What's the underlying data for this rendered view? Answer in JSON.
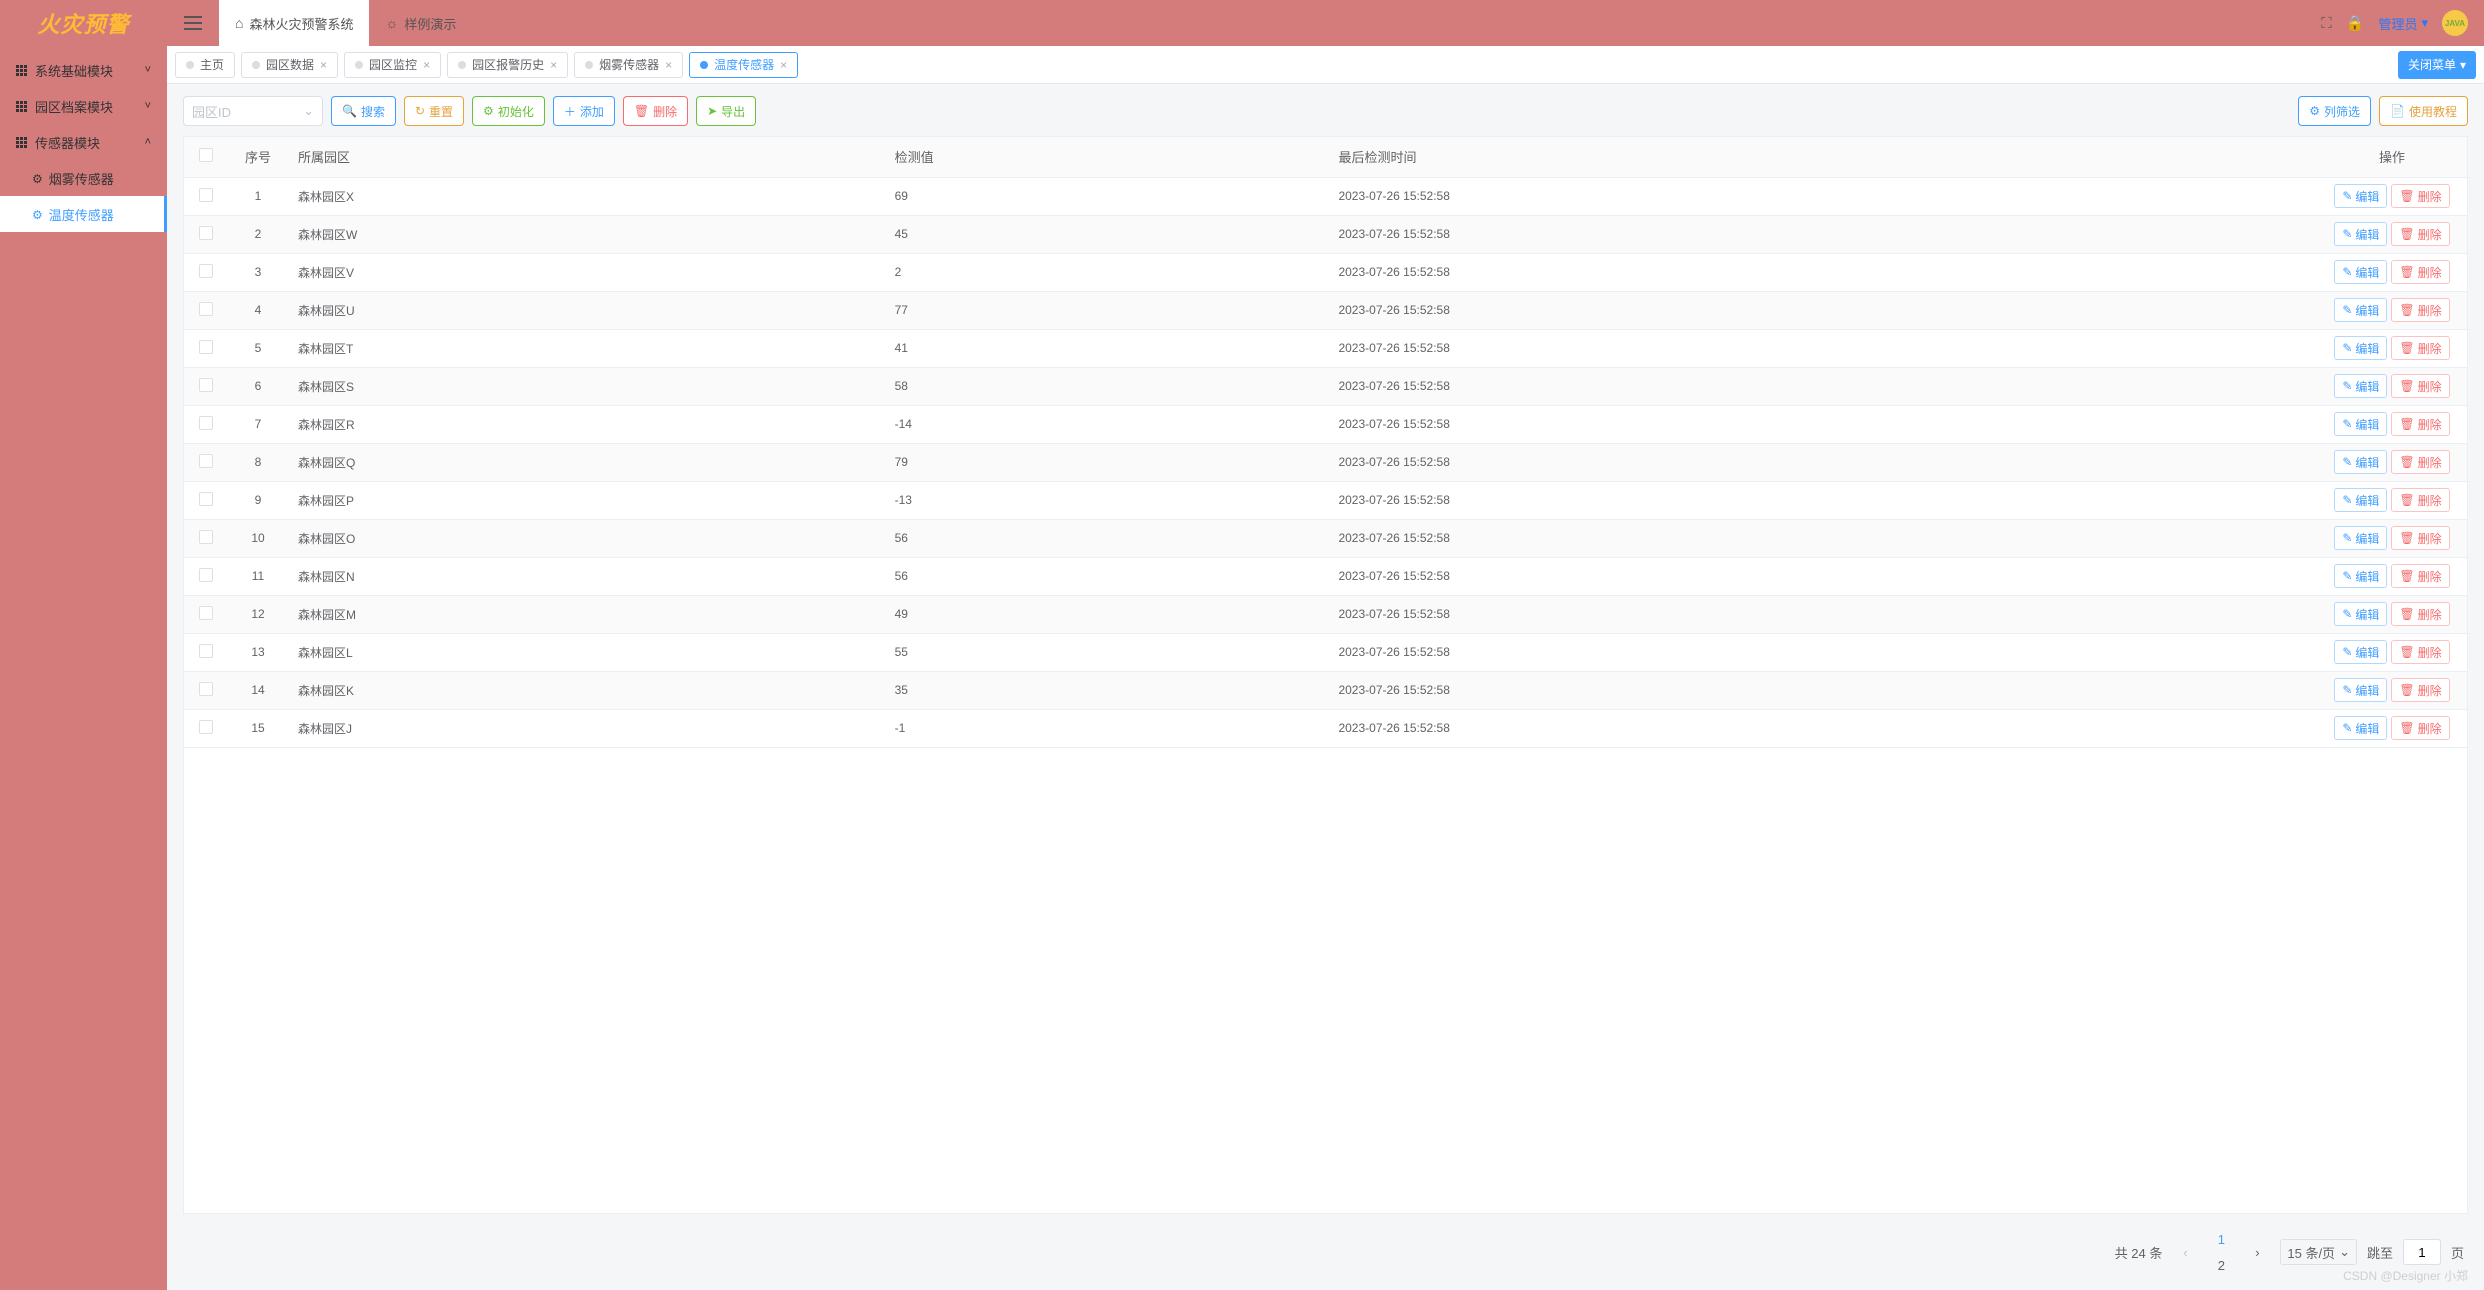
{
  "brand": "火灾预警",
  "topTabs": [
    {
      "label": "森林火灾预警系统",
      "icon": "home"
    },
    {
      "label": "样例演示",
      "icon": "sun"
    }
  ],
  "topRight": {
    "adminLabel": "管理员",
    "avatarText": "JAVA"
  },
  "sidebar": {
    "groups": [
      {
        "label": "系统基础模块",
        "expanded": false
      },
      {
        "label": "园区档案模块",
        "expanded": false
      },
      {
        "label": "传感器模块",
        "expanded": true,
        "children": [
          {
            "label": "烟雾传感器",
            "active": false
          },
          {
            "label": "温度传感器",
            "active": true
          }
        ]
      }
    ]
  },
  "tabs": [
    {
      "label": "主页",
      "closable": false,
      "active": false
    },
    {
      "label": "园区数据",
      "closable": true,
      "active": false
    },
    {
      "label": "园区监控",
      "closable": true,
      "active": false
    },
    {
      "label": "园区报警历史",
      "closable": true,
      "active": false
    },
    {
      "label": "烟雾传感器",
      "closable": true,
      "active": false
    },
    {
      "label": "温度传感器",
      "closable": true,
      "active": true
    }
  ],
  "closeMenuLabel": "关闭菜单",
  "toolbar": {
    "selectPlaceholder": "园区ID",
    "search": "搜索",
    "reset": "重置",
    "init": "初始化",
    "add": "添加",
    "delete": "删除",
    "export": "导出",
    "columnFilter": "列筛选",
    "tutorial": "使用教程"
  },
  "table": {
    "columns": {
      "seq": "序号",
      "park": "所属园区",
      "value": "检测值",
      "time": "最后检测时间",
      "ops": "操作"
    },
    "opEdit": "编辑",
    "opDelete": "删除",
    "rows": [
      {
        "seq": 1,
        "park": "森林园区X",
        "value": "69",
        "time": "2023-07-26 15:52:58"
      },
      {
        "seq": 2,
        "park": "森林园区W",
        "value": "45",
        "time": "2023-07-26 15:52:58"
      },
      {
        "seq": 3,
        "park": "森林园区V",
        "value": "2",
        "time": "2023-07-26 15:52:58"
      },
      {
        "seq": 4,
        "park": "森林园区U",
        "value": "77",
        "time": "2023-07-26 15:52:58"
      },
      {
        "seq": 5,
        "park": "森林园区T",
        "value": "41",
        "time": "2023-07-26 15:52:58"
      },
      {
        "seq": 6,
        "park": "森林园区S",
        "value": "58",
        "time": "2023-07-26 15:52:58"
      },
      {
        "seq": 7,
        "park": "森林园区R",
        "value": "-14",
        "time": "2023-07-26 15:52:58"
      },
      {
        "seq": 8,
        "park": "森林园区Q",
        "value": "79",
        "time": "2023-07-26 15:52:58"
      },
      {
        "seq": 9,
        "park": "森林园区P",
        "value": "-13",
        "time": "2023-07-26 15:52:58"
      },
      {
        "seq": 10,
        "park": "森林园区O",
        "value": "56",
        "time": "2023-07-26 15:52:58"
      },
      {
        "seq": 11,
        "park": "森林园区N",
        "value": "56",
        "time": "2023-07-26 15:52:58"
      },
      {
        "seq": 12,
        "park": "森林园区M",
        "value": "49",
        "time": "2023-07-26 15:52:58"
      },
      {
        "seq": 13,
        "park": "森林园区L",
        "value": "55",
        "time": "2023-07-26 15:52:58"
      },
      {
        "seq": 14,
        "park": "森林园区K",
        "value": "35",
        "time": "2023-07-26 15:52:58"
      },
      {
        "seq": 15,
        "park": "森林园区J",
        "value": "-1",
        "time": "2023-07-26 15:52:58"
      }
    ]
  },
  "pagination": {
    "totalText": "共 24 条",
    "pages": [
      "1",
      "2"
    ],
    "current": 1,
    "pageSizeLabel": "15 条/页",
    "jumpLabel": "跳至",
    "jumpValue": "1",
    "pageSuffix": "页"
  },
  "watermark": "CSDN @Designer 小郑"
}
